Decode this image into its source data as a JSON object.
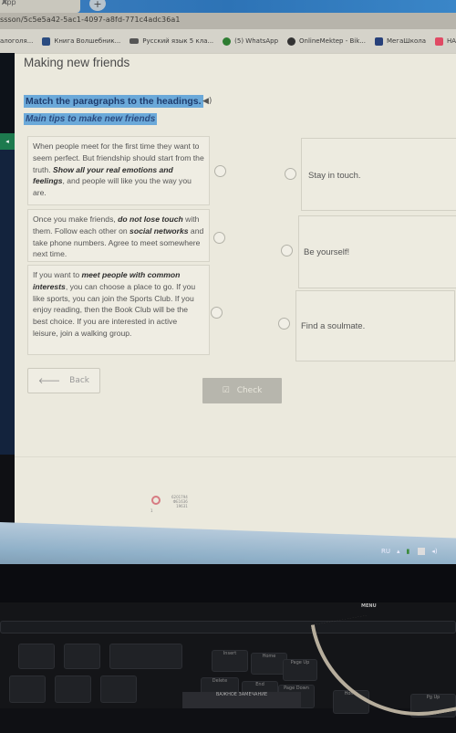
{
  "browser": {
    "tab_label": "App",
    "url": "ssson/5c5e5a42-5ac1-4097-a8fd-771c4adc36a1",
    "bookmarks": [
      {
        "label": "алоголя...",
        "icon": "bookmark-icon"
      },
      {
        "label": "Книга Волшебник...",
        "icon": "book-icon"
      },
      {
        "label": "Русский язык 5 кла...",
        "icon": "school-icon"
      },
      {
        "label": "(5) WhatsApp",
        "icon": "whatsapp-icon"
      },
      {
        "label": "OnlineMektep - Bik...",
        "icon": "onlinemektep-icon"
      },
      {
        "label": "МегаШкола",
        "icon": "megashkola-icon"
      },
      {
        "label": "НАИМ",
        "icon": "youtube-icon"
      }
    ]
  },
  "lesson": {
    "title": "Making new friends",
    "instruction": "Match the paragraphs to the headings.",
    "subtitle": "Main tips to make new friends",
    "paragraphs": [
      {
        "parts": [
          {
            "text": "When people meet for the first time they want to seem perfect. But friendship should start from the truth. ",
            "bold": false
          },
          {
            "text": "Show all your real emotions and feelings",
            "bold": true
          },
          {
            "text": ", and people will like you the way you are.",
            "bold": false
          }
        ]
      },
      {
        "parts": [
          {
            "text": "Once you make friends, ",
            "bold": false
          },
          {
            "text": "do not lose touch",
            "bold": true
          },
          {
            "text": " with them. Follow each other on ",
            "bold": false
          },
          {
            "text": "social networks",
            "bold": true
          },
          {
            "text": " and take phone numbers. Agree to meet somewhere next time.",
            "bold": false
          }
        ]
      },
      {
        "parts": [
          {
            "text": "If you want to ",
            "bold": false
          },
          {
            "text": "meet people with common interests",
            "bold": true
          },
          {
            "text": ", you can choose a place to go. If you like sports, you can join the Sports Club. If you enjoy reading, then the Book Club will be the best choice. If you are interested in active leisure, join a walking group.",
            "bold": false
          }
        ]
      }
    ],
    "headings": [
      "Stay in touch.",
      "Be yourself!",
      "Find a soulmate."
    ],
    "back_label": "Back",
    "check_label": "Check",
    "footer_page": "1",
    "footer_lines": [
      "6201794",
      "ФЕ1636",
      "19631"
    ]
  },
  "taskbar": {
    "language": "RU"
  },
  "monitor": {
    "menu_label": "MENU"
  },
  "keyboard": {
    "keys": [
      "Insert",
      "Home",
      "Page Up",
      "Delete",
      "End",
      "Page Down",
      "Home",
      "Pg Up"
    ],
    "sticker": "ВАЖНОЕ ЗАМЕЧАНИЕ"
  }
}
